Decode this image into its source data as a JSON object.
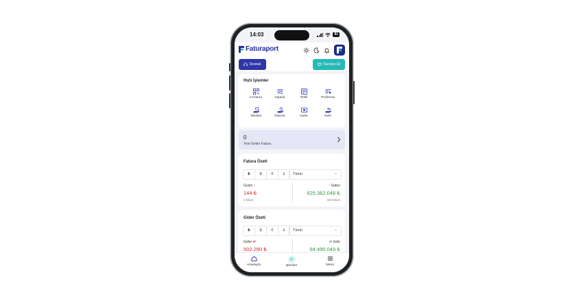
{
  "status": {
    "time": "14:03",
    "battery": "81"
  },
  "app": {
    "name": "Faturaport"
  },
  "actions": {
    "support": "Destek",
    "recommend": "Tavsiye Et"
  },
  "quick_actions": {
    "title": "Hızlı İşlemler",
    "items": [
      {
        "label": "e-Fatura",
        "icon": "qr-icon"
      },
      {
        "label": "Sipariş",
        "icon": "order-icon"
      },
      {
        "label": "Teklif",
        "icon": "offer-icon"
      },
      {
        "label": "Proforma",
        "icon": "proforma-icon"
      },
      {
        "label": "Tahsilat",
        "icon": "collection-icon"
      },
      {
        "label": "Ödeme",
        "icon": "payment-icon"
      },
      {
        "label": "Gider",
        "icon": "expense-icon"
      },
      {
        "label": "Gelir",
        "icon": "income-icon"
      }
    ]
  },
  "new_invoices": {
    "count": "0",
    "label": "Yeni Gelen Fatura"
  },
  "invoice_summary": {
    "title": "Fatura Özeti",
    "currencies": [
      "₺",
      "$",
      "€",
      "£"
    ],
    "filter": "Tümü",
    "incoming": {
      "label": "Gelen",
      "amount": "144 ₺",
      "sub": "1 fatura"
    },
    "outgoing": {
      "label": "Giden",
      "amount": "625.362.048 ₺",
      "sub": "504 fatura"
    }
  },
  "expense_summary": {
    "title": "Gider Özeti",
    "currencies": [
      "₺",
      "$",
      "€",
      "£"
    ],
    "filter": "Tümü",
    "expense": {
      "label": "Gider",
      "amount": "502.290 ₺"
    },
    "income": {
      "label": "Gelir",
      "amount": "84.490.049 ₺"
    }
  },
  "bottom_nav": {
    "home": "Anasayfa",
    "actions": "İşlemler",
    "menu": "Menü"
  },
  "colors": {
    "brand": "#27309b",
    "support_button": "#2f36a8",
    "recommend_button": "#27b9b7",
    "incoming": "#d8262a",
    "outgoing": "#2b9a3e"
  }
}
